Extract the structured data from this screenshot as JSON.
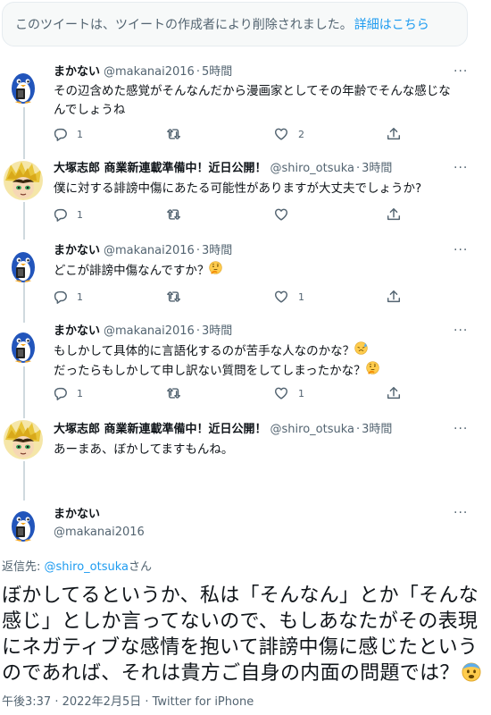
{
  "deleted_notice": {
    "text": "このツイートは、ツイートの作成者により削除されました。",
    "link": "詳細はこちら"
  },
  "tweets": [
    {
      "name": "まかない",
      "handle": "@makanai2016",
      "time": "5時間",
      "lines": [
        "その辺含めた感覚がそんなんだから漫画家としてその年齢でそんな感じな",
        "んでしょうね"
      ],
      "reply_count": "1",
      "like_count": "2",
      "avatar": "penguin-avatar"
    },
    {
      "name": "大塚志郎 商業新連載準備中！近日公開！",
      "handle": "@shiro_otsuka",
      "time": "3時間",
      "lines": [
        "僕に対する誹謗中傷にあたる可能性がありますが大丈夫でしょうか?"
      ],
      "reply_count": "1",
      "like_count": "",
      "avatar": "manga-character-avatar"
    },
    {
      "name": "まかない",
      "handle": "@makanai2016",
      "time": "3時間",
      "lines": [
        "どこが誹謗中傷なんですか？"
      ],
      "emojis": [
        "thinking-face"
      ],
      "reply_count": "1",
      "like_count": "1",
      "avatar": "penguin-avatar"
    },
    {
      "name": "まかない",
      "handle": "@makanai2016",
      "time": "3時間",
      "lines": [
        "もしかして具体的に言語化するのが苦手な人なのかな？",
        "だったらもしかして申し訳ない質問をしてしまったかな？"
      ],
      "emojis": [
        "sweat-face",
        "thinking-face"
      ],
      "reply_count": "1",
      "like_count": "1",
      "avatar": "penguin-avatar"
    },
    {
      "name": "大塚志郎 商業新連載準備中！近日公開！",
      "handle": "@shiro_otsuka",
      "time": "3時間",
      "lines": [
        "あーまあ、ぼかしてますもんね。"
      ],
      "reply_count": "1",
      "like_count": "",
      "avatar": "manga-character-avatar"
    }
  ],
  "main_tweet": {
    "name": "まかない",
    "handle": "@makanai2016",
    "reply_label": "返信先: ",
    "reply_handle": "@shiro_otsuka",
    "reply_suffix": "さん",
    "lines": [
      "ぼかしてるというか、私は「そんなん」とか「そんな",
      "感じ」としか言ってないので、もしあなたがその表現",
      "にネガティブな感情を抱いて誹謗中傷に感じたという",
      "のであれば、それは貴方ご自身の内面の問題では？"
    ],
    "emoji": "fearful-face",
    "timestamp": "午後3:37 · 2022年2月5日 · Twitter for iPhone"
  },
  "more_label": "···",
  "colors": {
    "link": "#1d9bf0",
    "secondary": "#536471",
    "penguin": "#2255bb"
  }
}
